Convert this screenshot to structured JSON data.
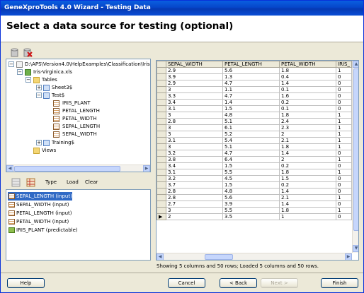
{
  "window": {
    "title": "GeneXproTools 4.0 Wizard - Testing Data"
  },
  "header": {
    "title": "Select a data source for testing (optional)"
  },
  "tree": {
    "root_path": "D:\\APS\\Version4.0\\HelpExamples\\Classification\\Iris",
    "file": "Iris-Virginica.xls",
    "tables_label": "Tables",
    "sheet": "Sheet3$",
    "test": "Test$",
    "fields": [
      "IRIS_PLANT",
      "PETAL_LENGTH",
      "PETAL_WIDTH",
      "SEPAL_LENGTH",
      "SEPAL_WIDTH"
    ],
    "training": "Training$",
    "views": "Views"
  },
  "variables_toolbar": {
    "type_label": "Type",
    "load_label": "Load",
    "clear_label": "Clear"
  },
  "variables": [
    {
      "label": "SEPAL_LENGTH (input)",
      "selected": true
    },
    {
      "label": "SEPAL_WIDTH (input)",
      "selected": false
    },
    {
      "label": "PETAL_LENGTH (input)",
      "selected": false
    },
    {
      "label": "PETAL_WIDTH (input)",
      "selected": false
    },
    {
      "label": "IRIS_PLANT (predictable)",
      "selected": false
    }
  ],
  "grid": {
    "columns": [
      "SEPAL_WIDTH",
      "PETAL_LENGTH",
      "PETAL_WIDTH",
      "IRIS_"
    ],
    "rows": [
      [
        "2.9",
        "5.6",
        "1.8",
        "1"
      ],
      [
        "3.9",
        "1.3",
        "0.4",
        "0"
      ],
      [
        "2.9",
        "4.7",
        "1.4",
        "0"
      ],
      [
        "3",
        "1.1",
        "0.1",
        "0"
      ],
      [
        "3.3",
        "4.7",
        "1.6",
        "0"
      ],
      [
        "3.4",
        "1.4",
        "0.2",
        "0"
      ],
      [
        "3.1",
        "1.5",
        "0.1",
        "0"
      ],
      [
        "3",
        "4.8",
        "1.8",
        "1"
      ],
      [
        "2.8",
        "5.1",
        "2.4",
        "1"
      ],
      [
        "3",
        "6.1",
        "2.3",
        "1"
      ],
      [
        "3",
        "5.2",
        "2",
        "1"
      ],
      [
        "3.1",
        "5.4",
        "2.1",
        "1"
      ],
      [
        "3",
        "5.1",
        "1.8",
        "1"
      ],
      [
        "3.2",
        "4.7",
        "1.4",
        "0"
      ],
      [
        "3.8",
        "6.4",
        "2",
        "1"
      ],
      [
        "3.4",
        "1.5",
        "0.2",
        "0"
      ],
      [
        "3.1",
        "5.5",
        "1.8",
        "1"
      ],
      [
        "3.2",
        "4.5",
        "1.5",
        "0"
      ],
      [
        "3.7",
        "1.5",
        "0.2",
        "0"
      ],
      [
        "2.8",
        "4.8",
        "1.4",
        "0"
      ],
      [
        "2.8",
        "5.6",
        "2.1",
        "1"
      ],
      [
        "2.7",
        "3.9",
        "1.4",
        "0"
      ],
      [
        "3",
        "5.5",
        "1.8",
        "1"
      ],
      [
        "2",
        "3.5",
        "1",
        "0"
      ]
    ],
    "status": "Showing 5 columns and 50 rows; Loaded 5 columns and 50 rows."
  },
  "footer": {
    "help_label": "Help",
    "cancel_label": "Cancel",
    "back_label": "< Back",
    "next_label": "Next >",
    "finish_label": "Finish"
  }
}
